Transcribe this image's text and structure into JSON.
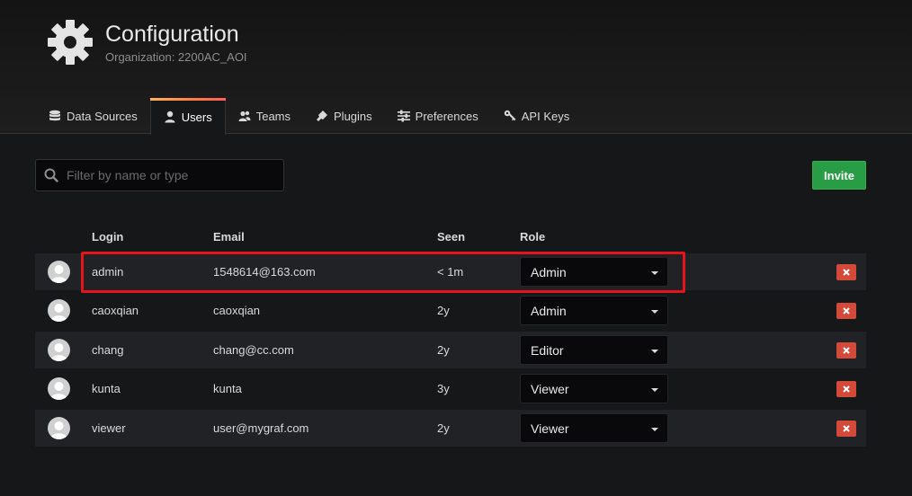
{
  "header": {
    "title": "Configuration",
    "subtitle": "Organization: 2200AC_AOI",
    "icon": "gear-icon"
  },
  "tabs": [
    {
      "label": "Data Sources",
      "icon": "database-icon",
      "active": false
    },
    {
      "label": "Users",
      "icon": "user-icon",
      "active": true
    },
    {
      "label": "Teams",
      "icon": "users-icon",
      "active": false
    },
    {
      "label": "Plugins",
      "icon": "plug-icon",
      "active": false
    },
    {
      "label": "Preferences",
      "icon": "sliders-icon",
      "active": false
    },
    {
      "label": "API Keys",
      "icon": "key-icon",
      "active": false
    }
  ],
  "search": {
    "placeholder": "Filter by name or type",
    "value": ""
  },
  "invite_label": "Invite",
  "table": {
    "columns": [
      "Login",
      "Email",
      "Seen",
      "Role"
    ],
    "rows": [
      {
        "login": "admin",
        "email": "1548614@163.com",
        "seen": "< 1m",
        "role": "Admin"
      },
      {
        "login": "caoxqian",
        "email": "caoxqian",
        "seen": "2y",
        "role": "Admin"
      },
      {
        "login": "chang",
        "email": "chang@cc.com",
        "seen": "2y",
        "role": "Editor"
      },
      {
        "login": "kunta",
        "email": "kunta",
        "seen": "3y",
        "role": "Viewer"
      },
      {
        "login": "viewer",
        "email": "user@mygraf.com",
        "seen": "2y",
        "role": "Viewer"
      }
    ]
  },
  "colors": {
    "accent_green": "#299c46",
    "delete_red": "#d44a3a",
    "highlight_red": "#e3141c"
  }
}
